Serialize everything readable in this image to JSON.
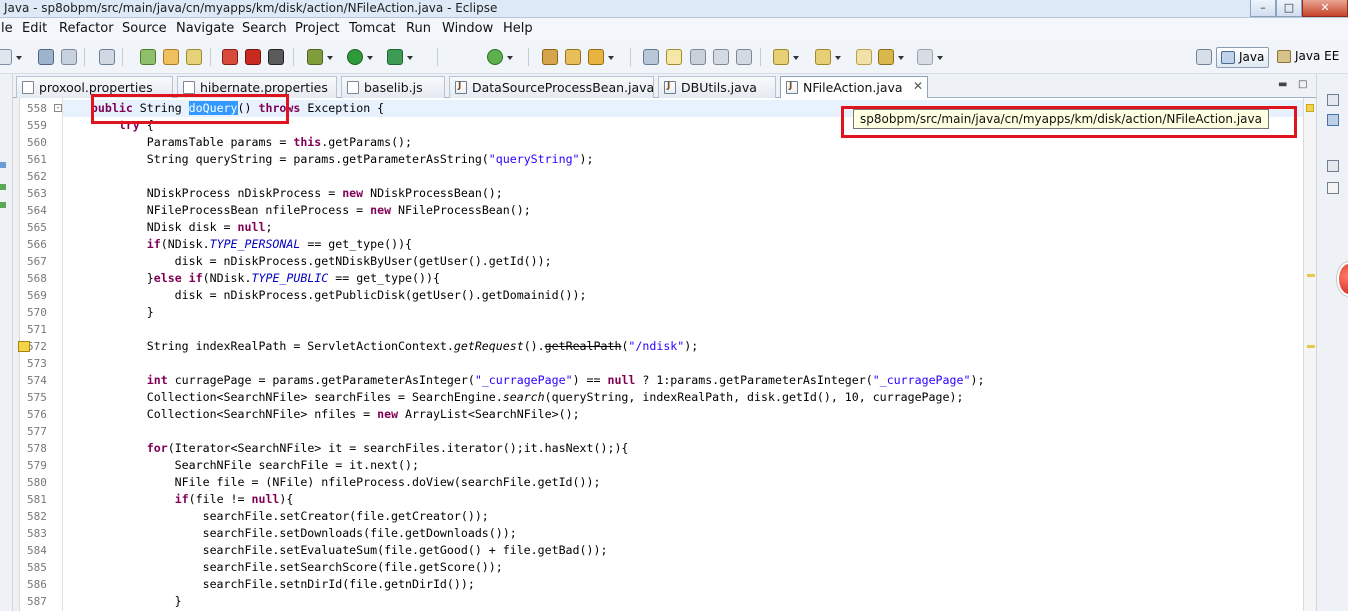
{
  "window": {
    "title": "Java - sp8obpm/src/main/java/cn/myapps/km/disk/action/NFileAction.java - Eclipse",
    "controls": {
      "minimize": "–",
      "maximize": "□",
      "close": "✕"
    }
  },
  "menu": [
    "le",
    "Edit",
    "Refactor",
    "Source",
    "Navigate",
    "Search",
    "Project",
    "Tomcat",
    "Run",
    "Window",
    "Help"
  ],
  "perspectives": [
    {
      "label": "Java",
      "active": true
    },
    {
      "label": "Java EE",
      "active": false
    }
  ],
  "tabs": [
    {
      "label": "proxool.properties",
      "icon": "file-icon",
      "active": false
    },
    {
      "label": "hibernate.properties",
      "icon": "file-icon",
      "active": false
    },
    {
      "label": "baselib.js",
      "icon": "js-file-icon",
      "active": false
    },
    {
      "label": "DataSourceProcessBean.java",
      "icon": "java-file-icon",
      "active": false
    },
    {
      "label": "DBUtils.java",
      "icon": "java-file-icon",
      "active": false
    },
    {
      "label": "NFileAction.java",
      "icon": "java-file-icon",
      "active": true,
      "close": "✕"
    }
  ],
  "tooltip": "sp8obpm/src/main/java/cn/myapps/km/disk/action/NFileAction.java",
  "colors": {
    "keyword": "#7f0055",
    "string": "#2a00ff",
    "static_field": "#0000c0",
    "annotation_box": "#e0141e",
    "selection": "#3399ff",
    "current_line": "#e8f2fe"
  },
  "code": [
    {
      "n": "558",
      "fold": "⊖",
      "current": true,
      "t": [
        [
          "",
          "    "
        ],
        [
          "k",
          "public"
        ],
        [
          "",
          " String "
        ],
        [
          "sel",
          "doQuery"
        ],
        [
          "",
          "() "
        ],
        [
          "k",
          "throws"
        ],
        [
          "",
          " Exception {"
        ]
      ]
    },
    {
      "n": "559",
      "t": [
        [
          "",
          "        "
        ],
        [
          "k",
          "try"
        ],
        [
          "",
          " {"
        ]
      ]
    },
    {
      "n": "560",
      "t": [
        [
          "",
          "            ParamsTable params = "
        ],
        [
          "k",
          "this"
        ],
        [
          "",
          ".getParams();"
        ]
      ]
    },
    {
      "n": "561",
      "t": [
        [
          "",
          "            String queryString = params.getParameterAsString("
        ],
        [
          "s",
          "\"queryString\""
        ],
        [
          "",
          ");"
        ]
      ]
    },
    {
      "n": "562",
      "t": [
        [
          "",
          ""
        ]
      ]
    },
    {
      "n": "563",
      "t": [
        [
          "",
          "            NDiskProcess nDiskProcess = "
        ],
        [
          "k",
          "new"
        ],
        [
          "",
          " NDiskProcessBean();"
        ]
      ]
    },
    {
      "n": "564",
      "t": [
        [
          "",
          "            NFileProcessBean nfileProcess = "
        ],
        [
          "k",
          "new"
        ],
        [
          "",
          " NFileProcessBean();"
        ]
      ]
    },
    {
      "n": "565",
      "t": [
        [
          "",
          "            NDisk disk = "
        ],
        [
          "k",
          "null"
        ],
        [
          "",
          ";"
        ]
      ]
    },
    {
      "n": "566",
      "t": [
        [
          "",
          "            "
        ],
        [
          "k",
          "if"
        ],
        [
          "",
          "(NDisk."
        ],
        [
          "st",
          "TYPE_PERSONAL"
        ],
        [
          "",
          " == get_type()){"
        ]
      ]
    },
    {
      "n": "567",
      "t": [
        [
          "",
          "                disk = nDiskProcess.getNDiskByUser(getUser().getId());"
        ]
      ]
    },
    {
      "n": "568",
      "t": [
        [
          "",
          "            }"
        ],
        [
          "k",
          "else"
        ],
        [
          "",
          " "
        ],
        [
          "k",
          "if"
        ],
        [
          "",
          "(NDisk."
        ],
        [
          "st",
          "TYPE_PUBLIC"
        ],
        [
          "",
          " == get_type()){"
        ]
      ]
    },
    {
      "n": "569",
      "t": [
        [
          "",
          "                disk = nDiskProcess.getPublicDisk(getUser().getDomainid());"
        ]
      ]
    },
    {
      "n": "570",
      "t": [
        [
          "",
          "            }"
        ]
      ]
    },
    {
      "n": "571",
      "t": [
        [
          "",
          ""
        ]
      ]
    },
    {
      "n": "572",
      "warn": true,
      "t": [
        [
          "",
          "            String indexRealPath = ServletActionContext."
        ],
        [
          "it",
          "getRequest"
        ],
        [
          "",
          "()."
        ],
        [
          "del",
          "getRealPath"
        ],
        [
          "",
          "("
        ],
        [
          "s",
          "\"/ndisk\""
        ],
        [
          "",
          ");"
        ]
      ]
    },
    {
      "n": "573",
      "t": [
        [
          "",
          ""
        ]
      ]
    },
    {
      "n": "574",
      "t": [
        [
          "",
          "            "
        ],
        [
          "k",
          "int"
        ],
        [
          "",
          " curragePage = params.getParameterAsInteger("
        ],
        [
          "s",
          "\"_curragePage\""
        ],
        [
          "",
          ") == "
        ],
        [
          "k",
          "null"
        ],
        [
          "",
          " ? 1:params.getParameterAsInteger("
        ],
        [
          "s",
          "\"_curragePage\""
        ],
        [
          "",
          ");"
        ]
      ]
    },
    {
      "n": "575",
      "t": [
        [
          "",
          "            Collection<SearchNFile> searchFiles = SearchEngine."
        ],
        [
          "it",
          "search"
        ],
        [
          "",
          "(queryString, indexRealPath, disk.getId(), 10, curragePage);"
        ]
      ]
    },
    {
      "n": "576",
      "t": [
        [
          "",
          "            Collection<SearchNFile> nfiles = "
        ],
        [
          "k",
          "new"
        ],
        [
          "",
          " ArrayList<SearchNFile>();"
        ]
      ]
    },
    {
      "n": "577",
      "t": [
        [
          "",
          ""
        ]
      ]
    },
    {
      "n": "578",
      "t": [
        [
          "",
          "            "
        ],
        [
          "k",
          "for"
        ],
        [
          "",
          "(Iterator<SearchNFile> it = searchFiles.iterator();it.hasNext();){"
        ]
      ]
    },
    {
      "n": "579",
      "t": [
        [
          "",
          "                SearchNFile searchFile = it.next();"
        ]
      ]
    },
    {
      "n": "580",
      "t": [
        [
          "",
          "                NFile file = (NFile) nfileProcess.doView(searchFile.getId());"
        ]
      ]
    },
    {
      "n": "581",
      "t": [
        [
          "",
          "                "
        ],
        [
          "k",
          "if"
        ],
        [
          "",
          "(file != "
        ],
        [
          "k",
          "null"
        ],
        [
          "",
          "){"
        ]
      ]
    },
    {
      "n": "582",
      "t": [
        [
          "",
          "                    searchFile.setCreator(file.getCreator());"
        ]
      ]
    },
    {
      "n": "583",
      "t": [
        [
          "",
          "                    searchFile.setDownloads(file.getDownloads());"
        ]
      ]
    },
    {
      "n": "584",
      "t": [
        [
          "",
          "                    searchFile.setEvaluateSum(file.getGood() + file.getBad());"
        ]
      ]
    },
    {
      "n": "585",
      "t": [
        [
          "",
          "                    searchFile.setSearchScore(file.getScore());"
        ]
      ]
    },
    {
      "n": "586",
      "t": [
        [
          "",
          "                    searchFile.setnDirId(file.getnDirId());"
        ]
      ]
    },
    {
      "n": "587",
      "t": [
        [
          "",
          "                }"
        ]
      ]
    }
  ]
}
